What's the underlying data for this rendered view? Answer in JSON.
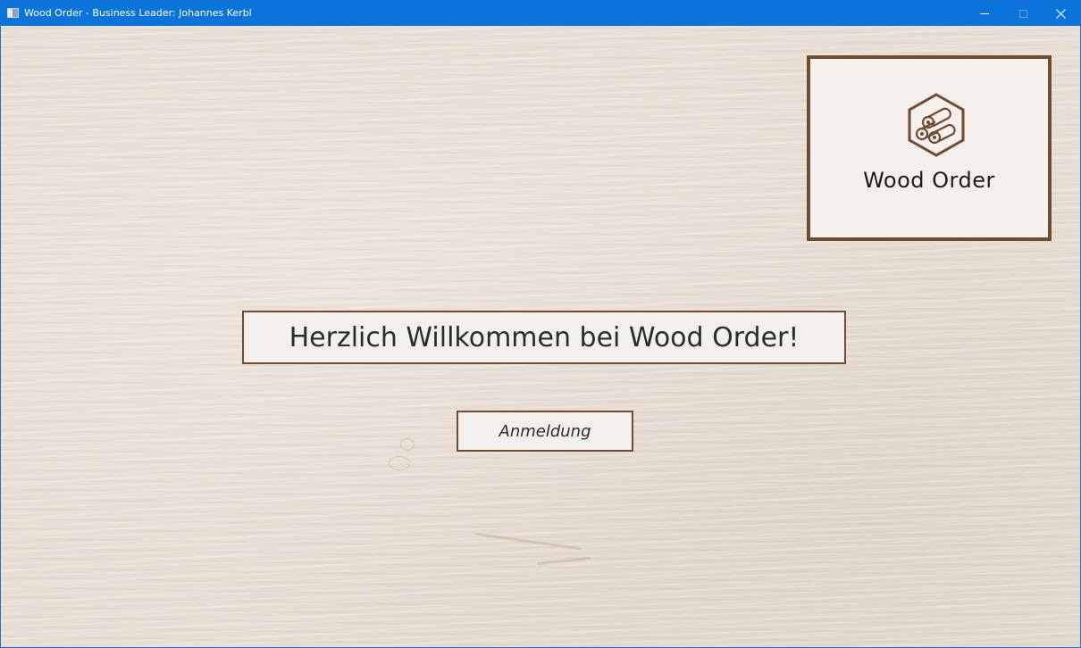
{
  "window": {
    "title": "Wood Order - Business Leader: Johannes Kerbl",
    "controls": {
      "minimize_icon": "minimize-icon",
      "maximize_icon": "maximize-icon",
      "close_icon": "close-icon"
    }
  },
  "logo": {
    "icon": "wood-logs-icon",
    "text": "Wood Order"
  },
  "main": {
    "welcome_text": "Herzlich Willkommen bei Wood Order!",
    "login_label": "Anmeldung"
  },
  "colors": {
    "titlebar": "#0a74da",
    "accent_brown": "#6e4b33",
    "panel_bg": "#f4f0eb",
    "wood_bg": "#e7ddd2"
  }
}
